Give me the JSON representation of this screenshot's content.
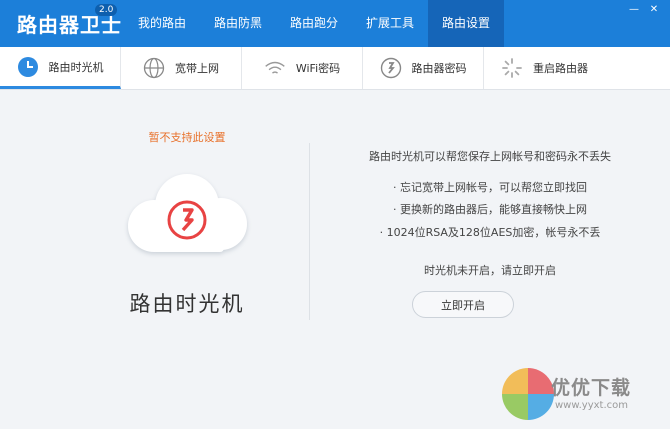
{
  "app": {
    "title": "路由器卫士",
    "version": "2.0"
  },
  "nav": [
    {
      "label": "我的路由"
    },
    {
      "label": "路由防黑"
    },
    {
      "label": "路由跑分"
    },
    {
      "label": "扩展工具"
    },
    {
      "label": "路由设置"
    }
  ],
  "window": {
    "minimize": "—",
    "close": "✕"
  },
  "tabs": [
    {
      "label": "路由时光机",
      "icon": "clock-icon"
    },
    {
      "label": "宽带上网",
      "icon": "globe-icon"
    },
    {
      "label": "WiFi密码",
      "icon": "wifi-icon"
    },
    {
      "label": "路由器密码",
      "icon": "lock-icon"
    },
    {
      "label": "重启路由器",
      "icon": "restart-icon"
    }
  ],
  "main": {
    "unsupported": "暂不支持此设置",
    "device_name": "路由时光机",
    "headline": "路由时光机可以帮您保存上网帐号和密码永不丢失",
    "features": [
      "· 忘记宽带上网帐号，可以帮您立即找回",
      "· 更换新的路由器后，能够直接畅快上网",
      "· 1024位RSA及128位AES加密，帐号永不丢"
    ],
    "status": "时光机未开启，请立即开启",
    "open_button": "立即开启"
  },
  "watermark": {
    "text": "优优下载",
    "url": "www.yyxt.com"
  },
  "colors": {
    "brand": "#1c7fd9",
    "accent_orange": "#e8702a",
    "accent_red": "#e84343"
  }
}
